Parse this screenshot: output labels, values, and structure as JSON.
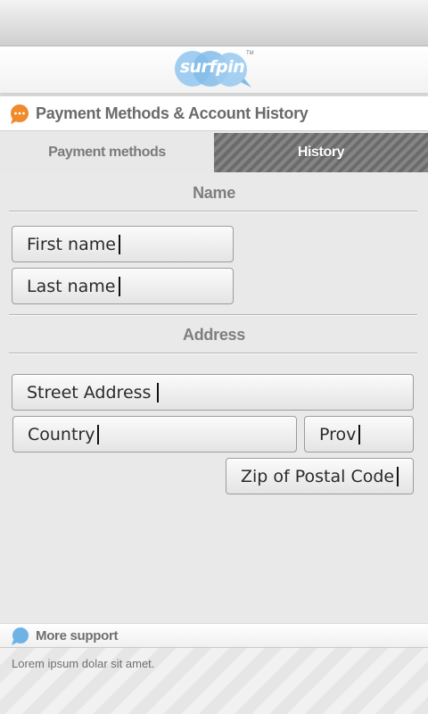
{
  "brand": {
    "logo_text": "surfpin",
    "trademark": "TM",
    "color_blue": "#7fb9e8",
    "color_orange": "#f08a2c"
  },
  "header": {
    "title": "Payment Methods & Account History",
    "icon": "chat-bubble-icon"
  },
  "tabs": [
    {
      "label": "Payment methods",
      "active": true
    },
    {
      "label": "History",
      "active": false
    }
  ],
  "form": {
    "name_section": "Name",
    "first_name_placeholder": "First name",
    "last_name_placeholder": "Last name",
    "address_section": "Address",
    "street_placeholder": "Street Address",
    "country_placeholder": "Country",
    "province_placeholder": "Prov",
    "zip_placeholder": "Zip of Postal Code"
  },
  "footer": {
    "support_label": "More support",
    "support_icon": "speech-bubble-icon",
    "text": "Lorem ipsum dolar sit amet."
  }
}
